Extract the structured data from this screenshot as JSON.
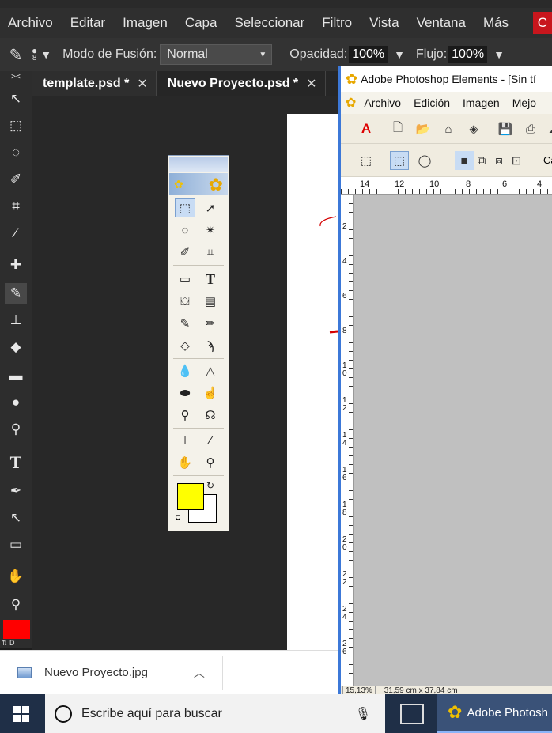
{
  "menubar": {
    "items": [
      "Archivo",
      "Editar",
      "Imagen",
      "Capa",
      "Seleccionar",
      "Filtro",
      "Vista",
      "Ventana",
      "Más"
    ],
    "extra": "C"
  },
  "options": {
    "brush_size": "8",
    "blend_label": "Modo de Fusión:",
    "blend_value": "Normal",
    "opacity_label": "Opacidad:",
    "opacity_value": "100%",
    "flow_label": "Flujo:",
    "flow_value": "100%"
  },
  "tabs": [
    {
      "label": "template.psd *"
    },
    {
      "label": "Nuevo Proyecto.psd *"
    }
  ],
  "colors": {
    "foreground_left": "#ff0000",
    "toolbox_foreground": "#ffff00",
    "toolbox_background": "#ffffff",
    "accent": "#3c78d8"
  },
  "pse": {
    "title": "Adobe Photoshop Elements - [Sin tí",
    "menu": [
      "Archivo",
      "Edición",
      "Imagen",
      "Mejo"
    ],
    "ruler_h": [
      "14",
      "12",
      "10",
      "8",
      "6",
      "4"
    ],
    "ruler_v": [
      "2",
      "4",
      "6",
      "8",
      "10",
      "12",
      "14",
      "16",
      "18",
      "20",
      "22",
      "24",
      "26"
    ],
    "toolbar2_text": "Ca",
    "status": "15,13%",
    "status2": "31,59 cm x 37,84 cm"
  },
  "download": {
    "filename": "Nuevo Proyecto.jpg"
  },
  "taskbar": {
    "search_placeholder": "Escribe aquí para buscar",
    "app_label": "Adobe Photosh"
  }
}
